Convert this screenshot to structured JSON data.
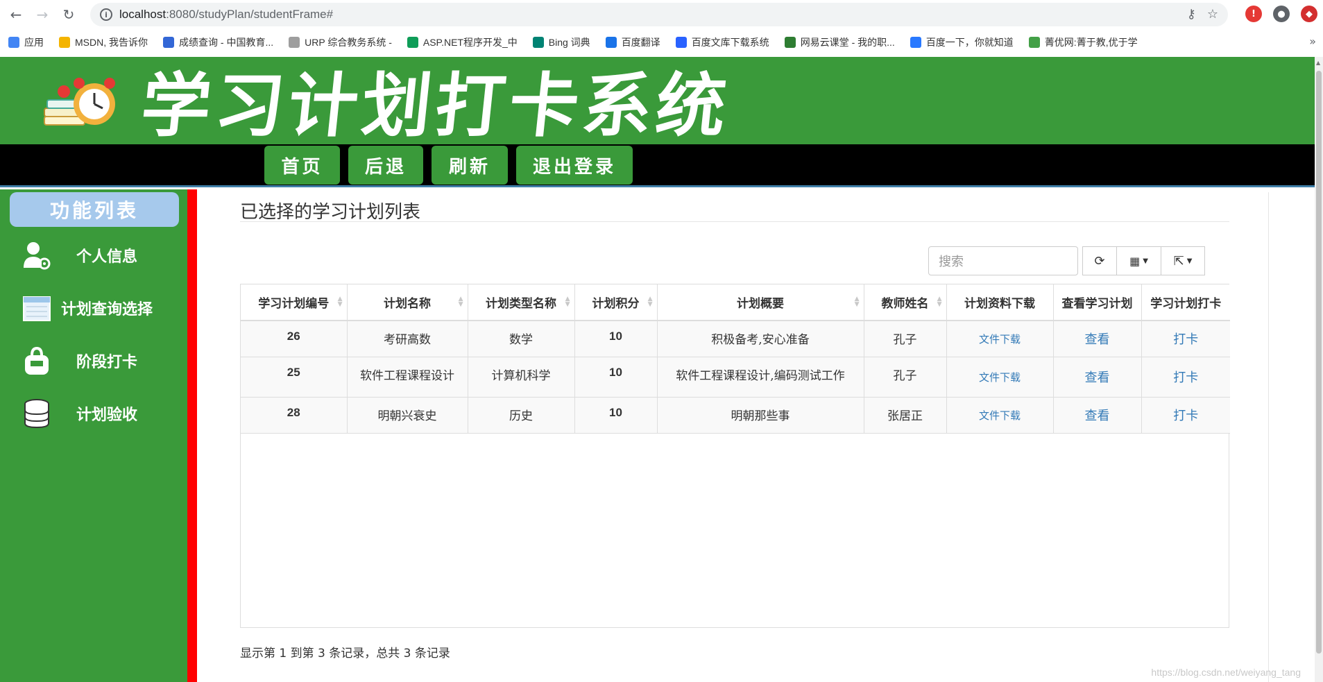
{
  "browser": {
    "url_host": "localhost",
    "url_rest": ":8080/studyPlan/studentFrame#",
    "bookmarks": [
      {
        "label": "应用",
        "color": "#4285f4"
      },
      {
        "label": "MSDN, 我告诉你",
        "color": "#f4b400"
      },
      {
        "label": "成绩查询 - 中国教育...",
        "color": "#3367d6"
      },
      {
        "label": "URP 综合教务系统 -",
        "color": "#9e9e9e"
      },
      {
        "label": "ASP.NET程序开发_中",
        "color": "#0f9d58"
      },
      {
        "label": "Bing 词典",
        "color": "#008373"
      },
      {
        "label": "百度翻译",
        "color": "#1a73e8"
      },
      {
        "label": "百度文库下载系统",
        "color": "#2962ff"
      },
      {
        "label": "网易云课堂 - 我的职...",
        "color": "#2e7d32"
      },
      {
        "label": "百度一下，你就知道",
        "color": "#2979ff"
      },
      {
        "label": "菁优网:菁于教,优于学",
        "color": "#43a047"
      }
    ],
    "more": "»"
  },
  "header": {
    "title": "学习计划打卡系统",
    "nav": [
      "首页",
      "后退",
      "刷新",
      "退出登录"
    ]
  },
  "sidebar": {
    "title": "功能列表",
    "items": [
      {
        "label": "个人信息",
        "icon": "user-settings-icon"
      },
      {
        "label": "计划查询选择",
        "icon": "calendar-icon"
      },
      {
        "label": "阶段打卡",
        "icon": "bag-icon"
      },
      {
        "label": "计划验收",
        "icon": "database-icon"
      }
    ]
  },
  "main": {
    "heading": "已选择的学习计划列表",
    "search_placeholder": "搜索",
    "columns": [
      "学习计划编号",
      "计划名称",
      "计划类型名称",
      "计划积分",
      "计划概要",
      "教师姓名",
      "计划资料下载",
      "查看学习计划",
      "学习计划打卡"
    ],
    "rows": [
      {
        "id": "26",
        "name": "考研高数",
        "type": "数学",
        "score": "10",
        "summary": "积极备考,安心准备",
        "teacher": "孔子",
        "download": "文件下载",
        "view": "查看",
        "checkin": "打卡"
      },
      {
        "id": "25",
        "name": "软件工程课程设计",
        "type": "计算机科学",
        "score": "10",
        "summary": "软件工程课程设计,编码测试工作",
        "teacher": "孔子",
        "download": "文件下载",
        "view": "查看",
        "checkin": "打卡"
      },
      {
        "id": "28",
        "name": "明朝兴衰史",
        "type": "历史",
        "score": "10",
        "summary": "明朝那些事",
        "teacher": "张居正",
        "download": "文件下载",
        "view": "查看",
        "checkin": "打卡"
      }
    ],
    "pager": "显示第 1 到第 3 条记录，总共 3 条记录"
  },
  "watermark": "https://blog.csdn.net/weiyang_tang",
  "colors": {
    "header_green": "#3a9a3a",
    "divider_red": "#ff0000",
    "link_blue": "#337ab7",
    "sidebar_title_bg": "#a6c9ec"
  }
}
